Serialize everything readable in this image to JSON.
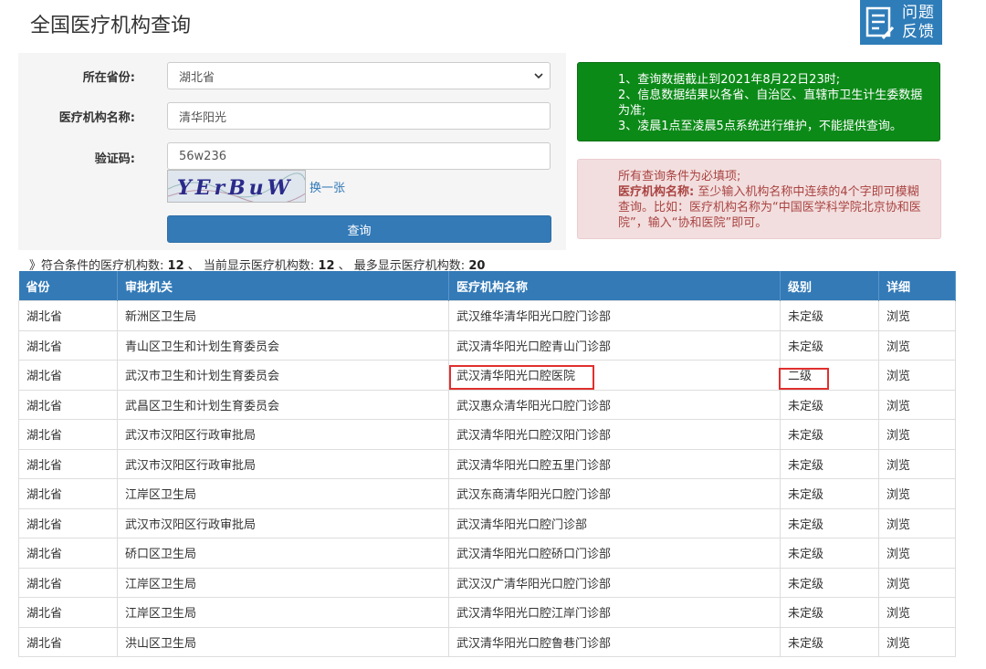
{
  "header": {
    "title": "全国医疗机构查询",
    "feedback_label": "问题反馈",
    "feedback_line1": "问题",
    "feedback_line2": "反馈"
  },
  "form": {
    "province_label": "所在省份:",
    "province_value": "湖北省",
    "name_label": "医疗机构名称:",
    "name_value": "清华阳光",
    "captcha_label": "验证码:",
    "captcha_value": "56w236",
    "captcha_image_text": "YErBuW",
    "refresh_label": "换一张",
    "submit_label": "查询"
  },
  "notice": {
    "line1": "1、查询数据截止到2021年8月22日23时;",
    "line2": "2、信息数据结果以各省、自治区、直辖市卫生计生委数据为准;",
    "line3": "3、凌晨1点至凌晨5点系统进行维护，不能提供查询。"
  },
  "warning": {
    "intro": "所有查询条件为必填项;",
    "bold_label": "医疗机构名称:",
    "text": "至少输入机构名称中连续的4个字即可模糊查询。比如：医疗机构名称为“中国医学科学院北京协和医院”，输入“协和医院”即可。"
  },
  "summary": {
    "prefix": "》符合条件的医疗机构数:",
    "matched": "12",
    "sep1": "、 当前显示医疗机构数:",
    "shown": "12",
    "sep2": "、 最多显示医疗机构数:",
    "max": "20"
  },
  "table": {
    "headers": [
      "省份",
      "审批机关",
      "医疗机构名称",
      "级别",
      "详细"
    ],
    "rows": [
      {
        "province": "湖北省",
        "authority": "新洲区卫生局",
        "name": "武汉维华清华阳光口腔门诊部",
        "level": "未定级",
        "detail": "浏览"
      },
      {
        "province": "湖北省",
        "authority": "青山区卫生和计划生育委员会",
        "name": "武汉清华阳光口腔青山门诊部",
        "level": "未定级",
        "detail": "浏览"
      },
      {
        "province": "湖北省",
        "authority": "武汉市卫生和计划生育委员会",
        "name": "武汉清华阳光口腔医院",
        "level": "二级",
        "detail": "浏览"
      },
      {
        "province": "湖北省",
        "authority": "武昌区卫生和计划生育委员会",
        "name": "武汉惠众清华阳光口腔门诊部",
        "level": "未定级",
        "detail": "浏览"
      },
      {
        "province": "湖北省",
        "authority": "武汉市汉阳区行政审批局",
        "name": "武汉清华阳光口腔汉阳门诊部",
        "level": "未定级",
        "detail": "浏览"
      },
      {
        "province": "湖北省",
        "authority": "武汉市汉阳区行政审批局",
        "name": "武汉清华阳光口腔五里门诊部",
        "level": "未定级",
        "detail": "浏览"
      },
      {
        "province": "湖北省",
        "authority": "江岸区卫生局",
        "name": "武汉东商清华阳光口腔门诊部",
        "level": "未定级",
        "detail": "浏览"
      },
      {
        "province": "湖北省",
        "authority": "武汉市汉阳区行政审批局",
        "name": "武汉清华阳光口腔门诊部",
        "level": "未定级",
        "detail": "浏览"
      },
      {
        "province": "湖北省",
        "authority": "硚口区卫生局",
        "name": "武汉清华阳光口腔硚口门诊部",
        "level": "未定级",
        "detail": "浏览"
      },
      {
        "province": "湖北省",
        "authority": "江岸区卫生局",
        "name": "武汉汉广清华阳光口腔门诊部",
        "level": "未定级",
        "detail": "浏览"
      },
      {
        "province": "湖北省",
        "authority": "江岸区卫生局",
        "name": "武汉清华阳光口腔江岸门诊部",
        "level": "未定级",
        "detail": "浏览"
      },
      {
        "province": "湖北省",
        "authority": "洪山区卫生局",
        "name": "武汉清华阳光口腔鲁巷门诊部",
        "level": "未定级",
        "detail": "浏览"
      }
    ]
  },
  "colors": {
    "primary": "#337ab7",
    "notice_green": "#0c8a18",
    "warning_bg": "#f2dede",
    "warning_text": "#a94442",
    "highlight": "#e0302f"
  }
}
